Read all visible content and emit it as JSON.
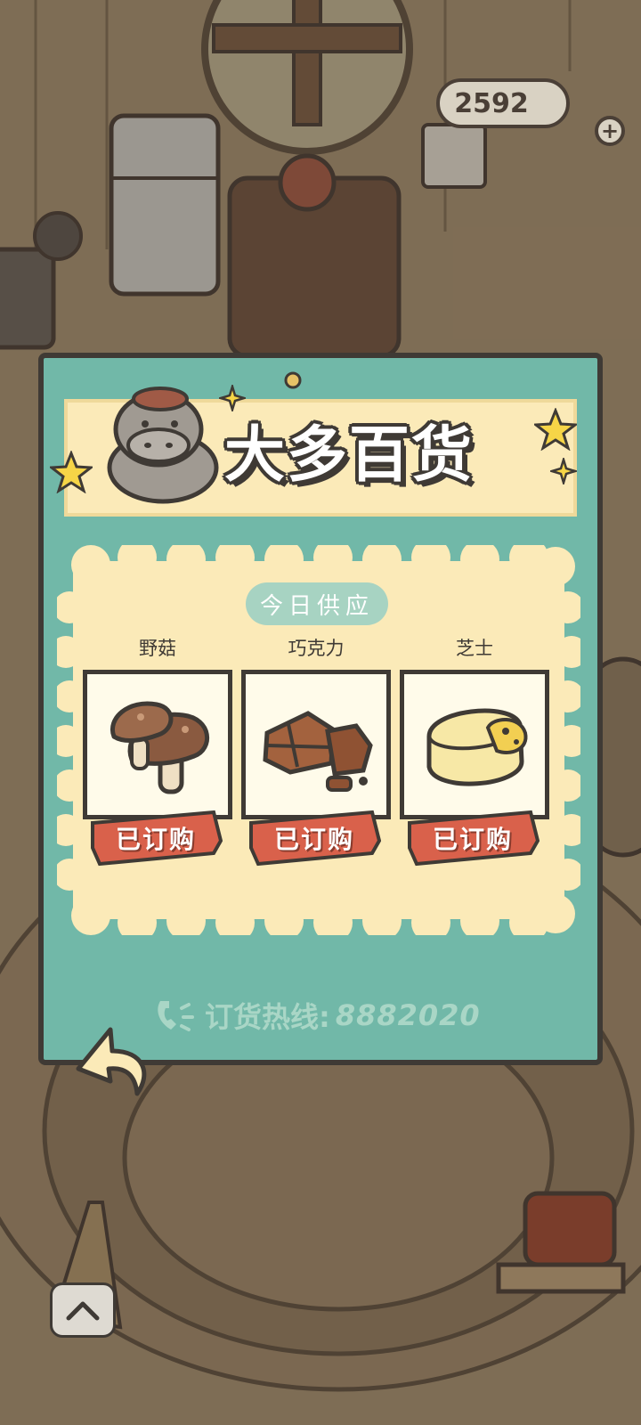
{
  "header": {
    "coins": "2592",
    "add_coins_icon": "plus-icon"
  },
  "shop": {
    "title": "大多百货",
    "today_label": "今日供应",
    "items": [
      {
        "name": "野菇",
        "status": "已订购",
        "icon": "mushroom-icon"
      },
      {
        "name": "巧克力",
        "status": "已订购",
        "icon": "chocolate-icon"
      },
      {
        "name": "芝士",
        "status": "已订购",
        "icon": "cheese-icon"
      }
    ],
    "hotline_label": "订货热线:",
    "hotline_number": "8882020"
  },
  "controls": {
    "back_icon": "back-arrow-icon",
    "scroll_up_icon": "chevron-up-icon"
  },
  "colors": {
    "panel": "#71b8a8",
    "cream": "#fbeab8",
    "ribbon": "#d9614b",
    "outline": "#3f3a35"
  }
}
